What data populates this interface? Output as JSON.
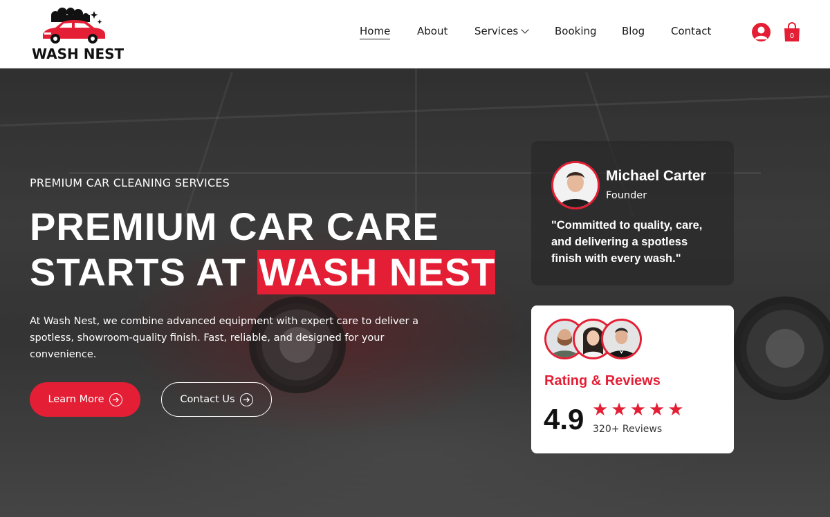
{
  "header": {
    "logo_text": "WASH NEST",
    "nav": [
      {
        "label": "Home",
        "active": true
      },
      {
        "label": "About",
        "active": false
      },
      {
        "label": "Services",
        "active": false,
        "has_dropdown": true
      },
      {
        "label": "Booking",
        "active": false
      },
      {
        "label": "Blog",
        "active": false
      },
      {
        "label": "Contact",
        "active": false
      }
    ],
    "user_icon": "user-circle-icon",
    "cart_icon": "shopping-bag-icon",
    "cart_count": "0"
  },
  "hero": {
    "eyebrow": "PREMIUM CAR CLEANING SERVICES",
    "headline_line1": "PREMIUM CAR CARE",
    "headline_line2_prefix": "STARTS AT ",
    "headline_accent": "WASH NEST",
    "description": "At Wash Nest, we combine advanced equipment with expert care to deliver a spotless, showroom-quality finish. Fast, reliable, and designed for your convenience.",
    "primary_button": "Learn More",
    "secondary_button": "Contact Us"
  },
  "founder_card": {
    "name": "Michael Carter",
    "role": "Founder",
    "quote": "\"Committed to quality, care, and delivering a spotless finish with every wash.\""
  },
  "rating_card": {
    "title": "Rating & Reviews",
    "score": "4.9",
    "stars": 5,
    "count": "320+ Reviews"
  },
  "colors": {
    "accent": "#e41f35",
    "text_dark": "#1a1a1a",
    "white": "#ffffff"
  }
}
